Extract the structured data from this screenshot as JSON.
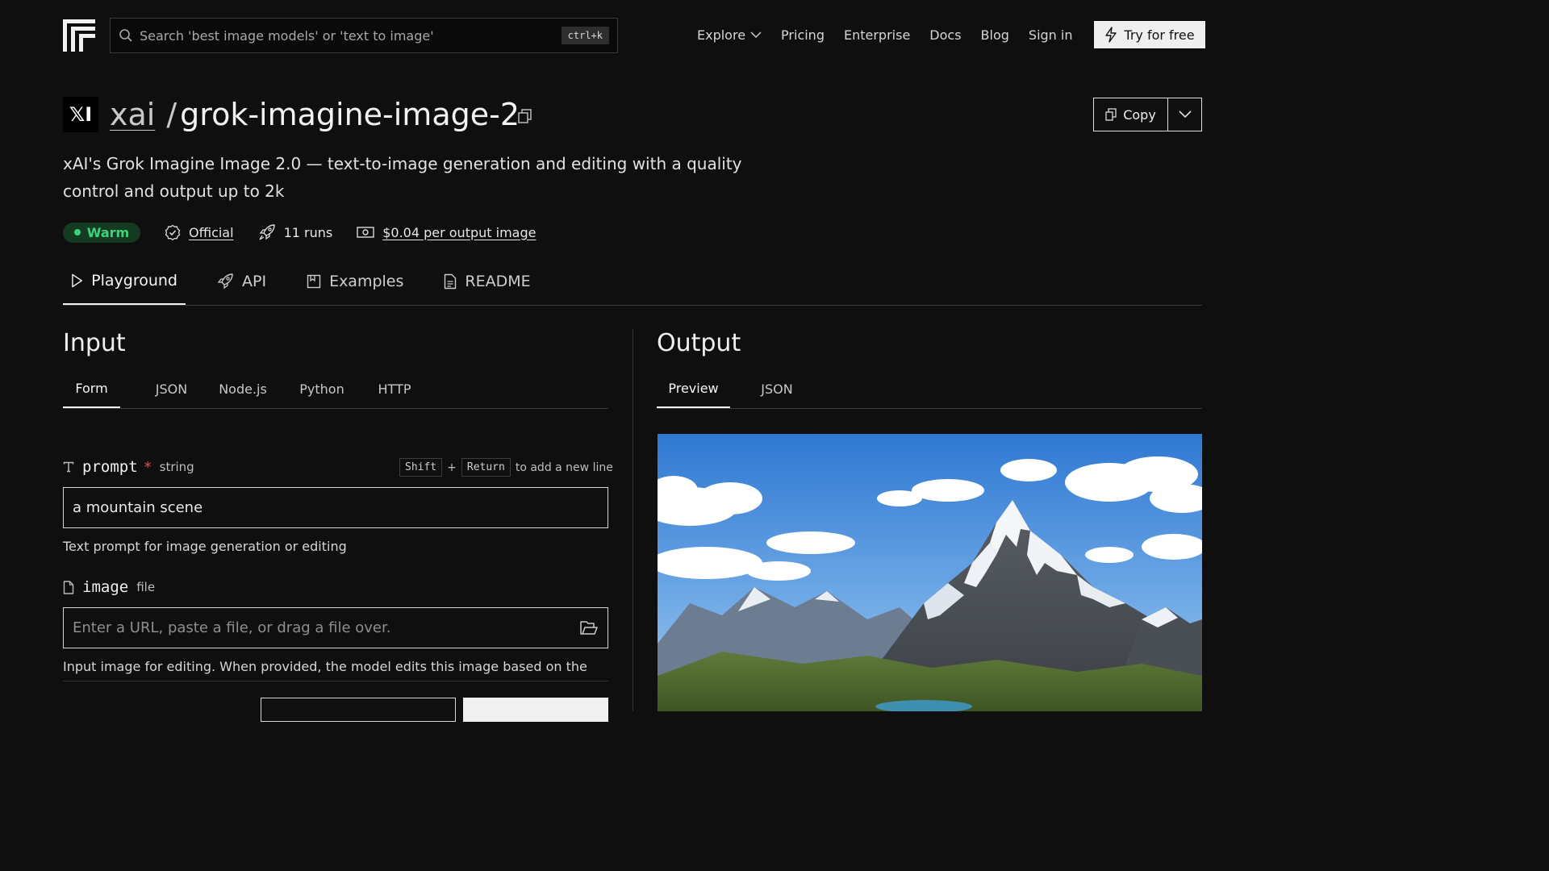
{
  "header": {
    "search_placeholder": "Search 'best image models' or 'text to image'",
    "search_shortcut": "ctrl+k",
    "nav": {
      "explore": "Explore",
      "pricing": "Pricing",
      "enterprise": "Enterprise",
      "docs": "Docs",
      "blog": "Blog",
      "sign_in": "Sign in"
    },
    "try_label": "Try for free"
  },
  "model": {
    "owner_badge": "𝕏I",
    "owner": "xai",
    "separator": "/",
    "name": "grok-imagine-image-2",
    "copy_label": "Copy",
    "description": "xAI's Grok Imagine Image 2.0 — text-to-image generation and editing with a quality control and output up to 2k",
    "status": "Warm",
    "official": "Official",
    "runs": "11 runs",
    "price": "$0.04 per output image"
  },
  "tabs": [
    {
      "label": "Playground"
    },
    {
      "label": "API"
    },
    {
      "label": "Examples"
    },
    {
      "label": "README"
    }
  ],
  "input": {
    "title": "Input",
    "tabs": [
      "Form",
      "JSON",
      "Node.js",
      "Python",
      "HTTP"
    ],
    "prompt": {
      "name": "prompt",
      "required_mark": "*",
      "type": "string",
      "hint_key1": "Shift",
      "hint_plus": "+",
      "hint_key2": "Return",
      "hint_text": "to add a new line",
      "value": "a mountain scene",
      "help": "Text prompt for image generation or editing"
    },
    "image": {
      "name": "image",
      "type": "file",
      "placeholder": "Enter a URL, paste a file, or drag a file over.",
      "help": "Input image for editing. When provided, the model edits this image based on the"
    }
  },
  "output": {
    "title": "Output",
    "tabs": [
      "Preview",
      "JSON"
    ]
  },
  "colors": {
    "background": "#0f0f0f",
    "status_green": "#3fd27b",
    "required_red": "#e0504c"
  }
}
